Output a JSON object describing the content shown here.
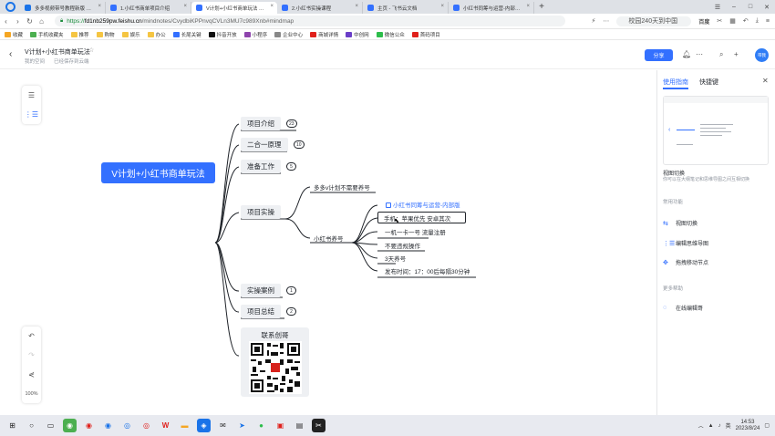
{
  "browser": {
    "tabs": [
      {
        "label": "多多视频带号教程新版 - 飞书",
        "color": "#1a73e8"
      },
      {
        "label": "1.小红书商单项目介绍",
        "color": "#3370ff"
      },
      {
        "label": "V计划+小红书商单玩法 - 飞书",
        "color": "#3370ff",
        "active": true
      },
      {
        "label": "2.小红书实操课程",
        "color": "#3370ff"
      },
      {
        "label": "主页 - 飞书云文档",
        "color": "#3370ff"
      },
      {
        "label": "小红书同筹与运营-内部版 - 飞",
        "color": "#3370ff"
      }
    ],
    "url_scheme": "https://",
    "url_domain": "fd1nb259pw.feishu.cn",
    "url_path": "/mindnotes/CvydbiKPPnvqCVLn3MU7c989Xnb#mindmap",
    "search_placeholder": "校园240天到中国",
    "search_engine": "百度",
    "bookmarks": [
      {
        "label": "收藏",
        "color": "#f5a623"
      },
      {
        "label": "手机收藏夹",
        "color": "#4caf50"
      },
      {
        "label": "推荐",
        "color": "#f5c542"
      },
      {
        "label": "购物",
        "color": "#f5c542"
      },
      {
        "label": "娱乐",
        "color": "#f5c542"
      },
      {
        "label": "办公",
        "color": "#f5c542"
      },
      {
        "label": "长尾关键",
        "color": "#3370ff"
      },
      {
        "label": "抖音开放",
        "color": "#111111"
      },
      {
        "label": "小程序",
        "color": "#8e44ad"
      },
      {
        "label": "企业中心",
        "color": "#888888"
      },
      {
        "label": "商城详情",
        "color": "#e0201b"
      },
      {
        "label": "中创网",
        "color": "#6a3ec8"
      },
      {
        "label": "微信公众",
        "color": "#2dbd4b"
      },
      {
        "label": "首码项目",
        "color": "#e0201b"
      }
    ]
  },
  "doc": {
    "title": "V计划+小红书商单玩法",
    "location": "我的空间",
    "save_status": "已经保存到云端",
    "share_label": "分享",
    "avatar_text": "带我"
  },
  "toolbar": {
    "zoom": "100%"
  },
  "mindmap": {
    "root": "V计划+小红书商单玩法",
    "branches": [
      {
        "label": "项目介绍",
        "count": "23"
      },
      {
        "label": "二合一原理",
        "count": "10"
      },
      {
        "label": "准备工作",
        "count": "5"
      },
      {
        "label": "项目实操",
        "count": ""
      },
      {
        "label": "实操案例",
        "count": "1"
      },
      {
        "label": "项目总结",
        "count": "2"
      },
      {
        "label": "联系创哥",
        "count": ""
      }
    ],
    "practice_children": {
      "first": "多多v计划不需要养号",
      "second": "小红书养号",
      "leaves": [
        "小红书同筹与运营-内部版",
        "手机：苹果优先 安卓其次",
        "一机一卡一号  流量注册",
        "不要违规操作",
        "3天养号",
        "发布时间：17：00后每隔30分钟"
      ]
    }
  },
  "panel": {
    "tabs": [
      "使用指南",
      "快捷键"
    ],
    "heading": "视图切换",
    "description": "你可以在大纲笔记和思维导图之间互相切换",
    "common_label": "常用功能",
    "items": [
      "视图切换",
      "编辑思维导图",
      "拖拽移动节点"
    ],
    "help_label": "更多帮助",
    "help_items": [
      "在线编辑哥"
    ]
  },
  "taskbar": {
    "time": "14:53",
    "date": "2023/8/24"
  }
}
